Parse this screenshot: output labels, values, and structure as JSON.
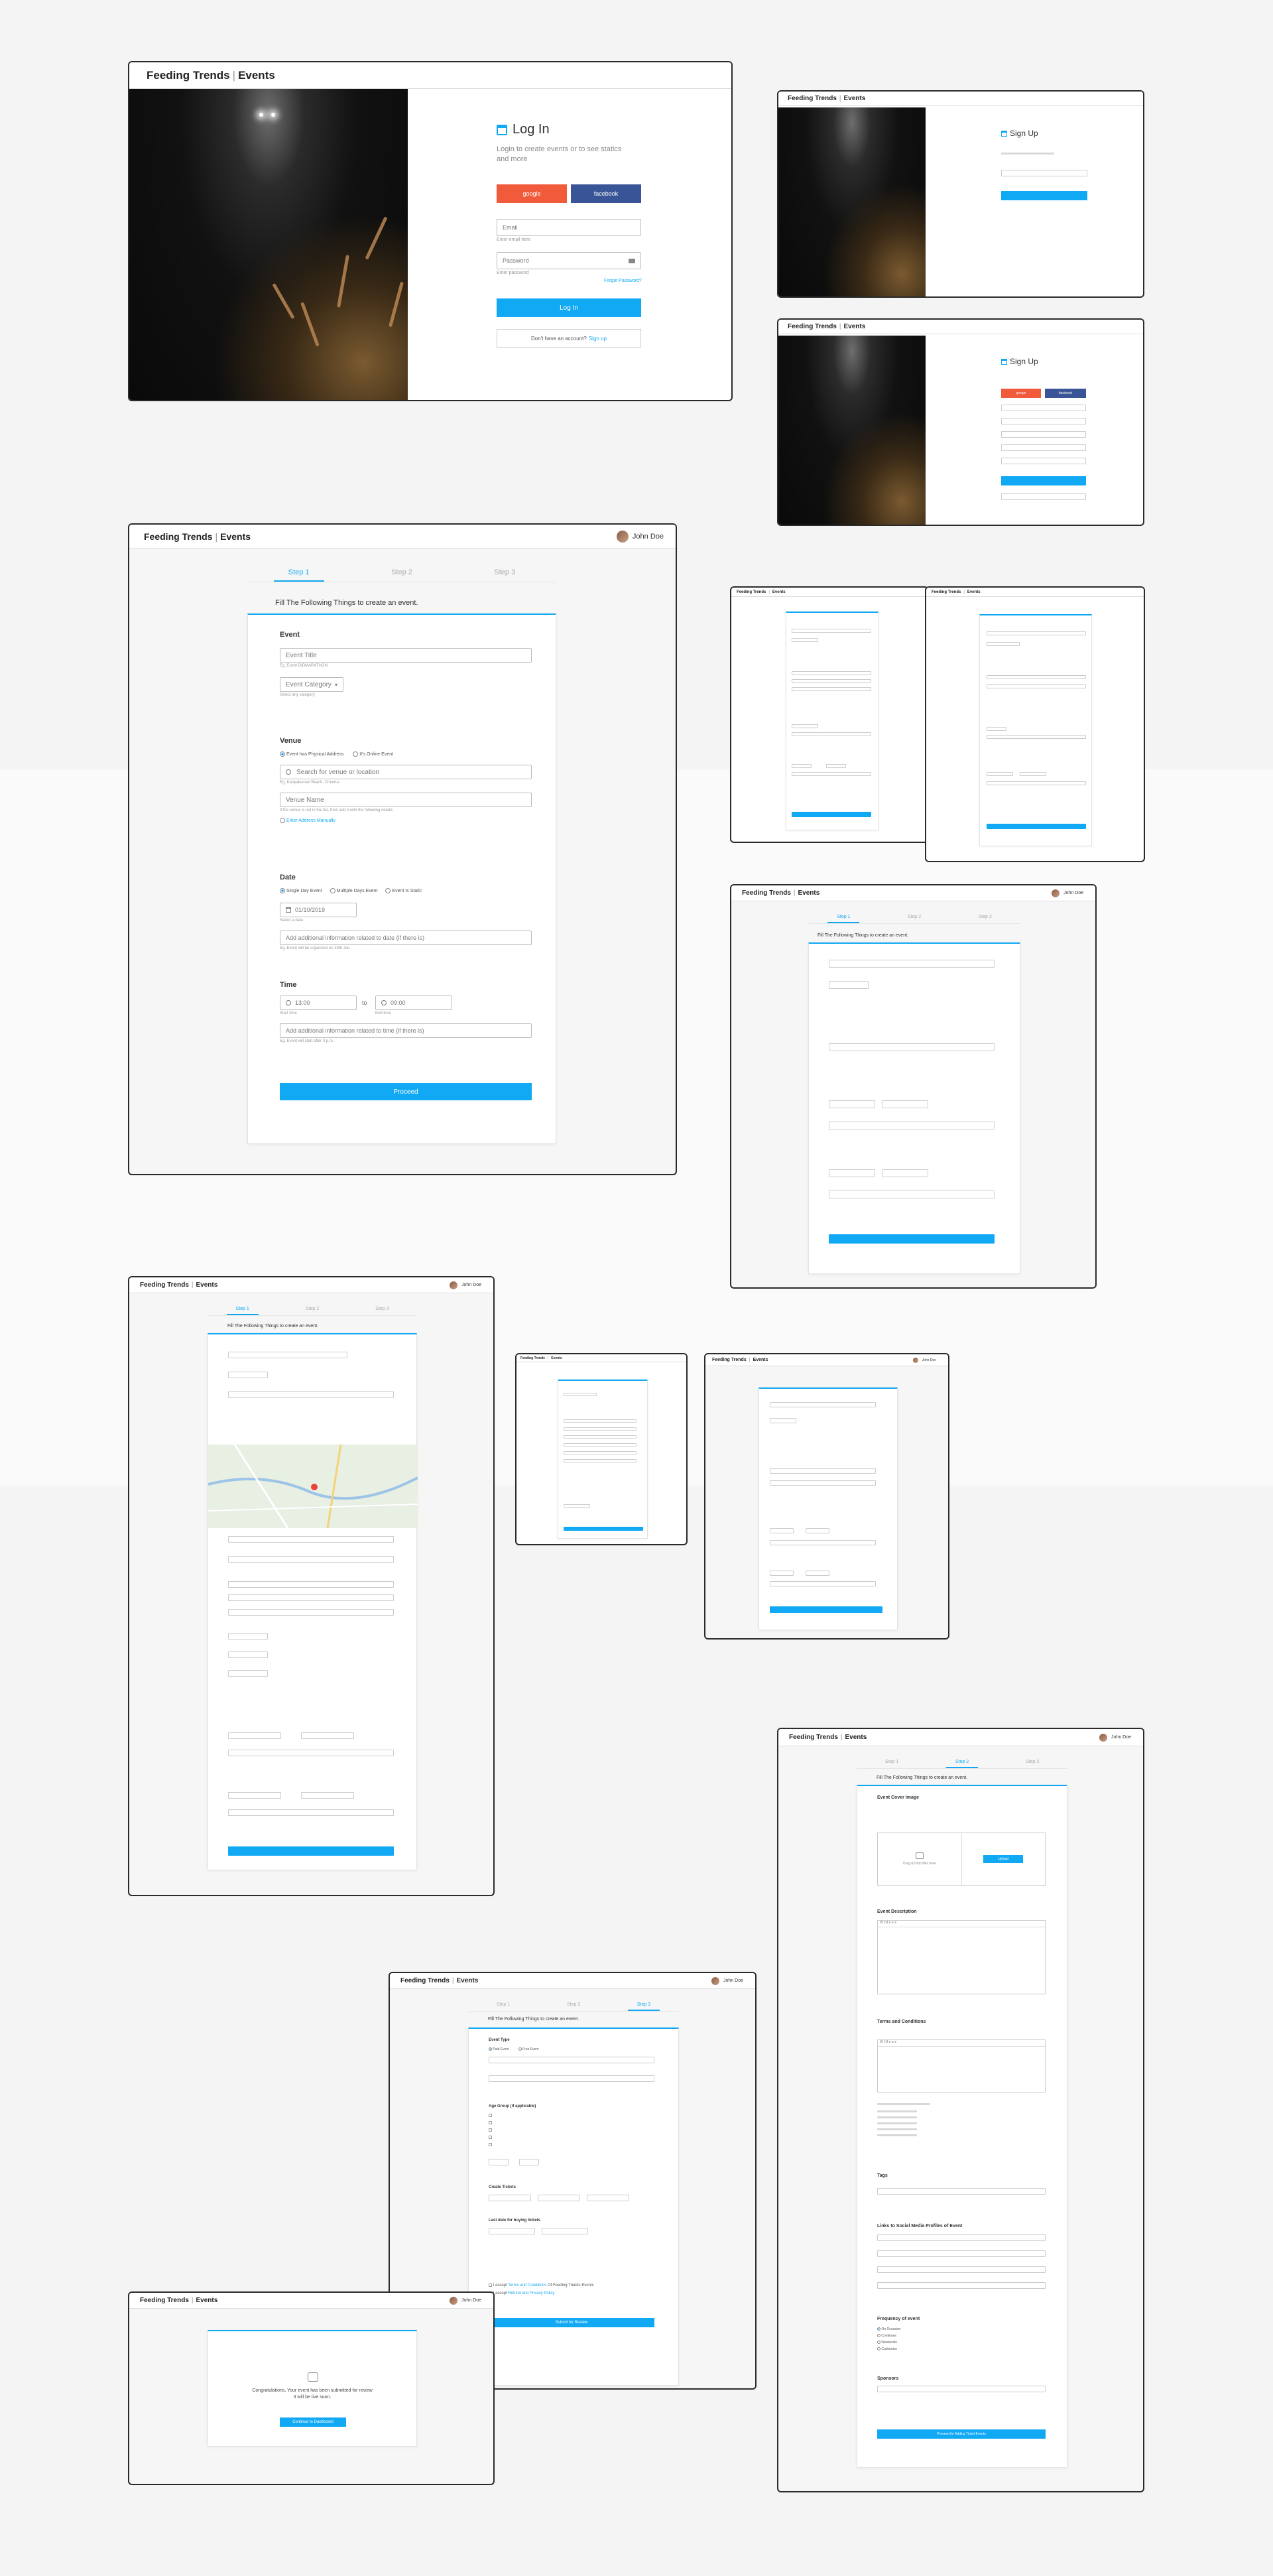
{
  "brand": {
    "name": "Feeding Trends",
    "section": "Events"
  },
  "user": {
    "name": "John Doe"
  },
  "login": {
    "title": "Log In",
    "subtitle": "Login to create events or to see statics and more",
    "google": "google",
    "facebook": "facebook",
    "email_placeholder": "Email",
    "email_hint": "Enter email here",
    "password_placeholder": "Password",
    "password_hint": "Enter password",
    "forgot": "Forgot Password?",
    "submit": "Log In",
    "signup_prompt": "Don't have an account?",
    "signup_link": "Sign up"
  },
  "signup": {
    "title": "Sign Up",
    "google": "google",
    "facebook": "facebook",
    "submit": "Sign Up"
  },
  "wizard": {
    "steps": [
      "Step 1",
      "Step 2",
      "Step 3"
    ],
    "heading": "Fill The Following Things to create an event.",
    "event_section": "Event",
    "event_title_placeholder": "Event Title",
    "event_title_hint": "Eg. Event DIDMARATHON",
    "event_category_placeholder": "Event Category",
    "event_category_hint": "Select any category",
    "venue_section": "Venue",
    "venue_option1": "Event has Physical Address",
    "venue_option2": "It's Online Event",
    "venue_search_placeholder": "Search for venue or location",
    "venue_search_hint": "Eg. Kanyakumari Beach, Chennai",
    "venue_name_placeholder": "Venue Name",
    "venue_name_hint": "If the venue is not in the list, then add it with the following details",
    "venue_add_details": "Enter Address Manually",
    "date_section": "Date",
    "date_option1": "Single Day Event",
    "date_option2": "Multiple Days Event",
    "date_option3": "Event Is Static",
    "date_value": "01/10/2019",
    "date_hint": "Select a date",
    "date_extra_placeholder": "Add additional information related to date (if there is)",
    "date_extra_hint": "Eg. Event will be organized on 30th Jan",
    "time_section": "Time",
    "time_start": "13:00",
    "time_start_hint": "Start time",
    "time_to": "to",
    "time_end": "09:00",
    "time_end_hint": "End time",
    "time_extra_placeholder": "Add additional information related to time (if there is)",
    "time_extra_hint": "Eg. Event will start after 3 p.m.",
    "proceed": "Proceed"
  },
  "step3": {
    "cover": "Event Cover Image",
    "cover_drop": "Drag & Drop files here",
    "upload": "Upload",
    "description": "Event Description",
    "terms": "Terms and Conditions",
    "tags": "Tags",
    "social": "Links to Social Media Profiles of Event",
    "frequency": "Frequency of event",
    "frequency_options": [
      "On Occasion",
      "Continues",
      "Weekends",
      "Customize"
    ],
    "sponsors": "Sponsors",
    "submit": "Proceed for Adding Ticket Events"
  },
  "step2": {
    "event_type": "Event Type",
    "type_options": [
      "Paid Event",
      "Free Event"
    ],
    "age_group": "Age Group (if applicable)",
    "tickets": "Create Tickets",
    "last_date": "Last date for buying tickets",
    "accept1_prefix": "I accept",
    "accept1_link": "Terms and Conditions",
    "accept1_suffix": "Of Feeding Trends Events",
    "accept2_prefix": "I accept",
    "accept2_link": "Refund and Privacy Policy",
    "submit": "Submit for Review"
  },
  "congrats": {
    "message": "Congratulations, Your event has been submitted for review",
    "message2": "It will be live soon.",
    "button": "Continue to Dashboard"
  }
}
